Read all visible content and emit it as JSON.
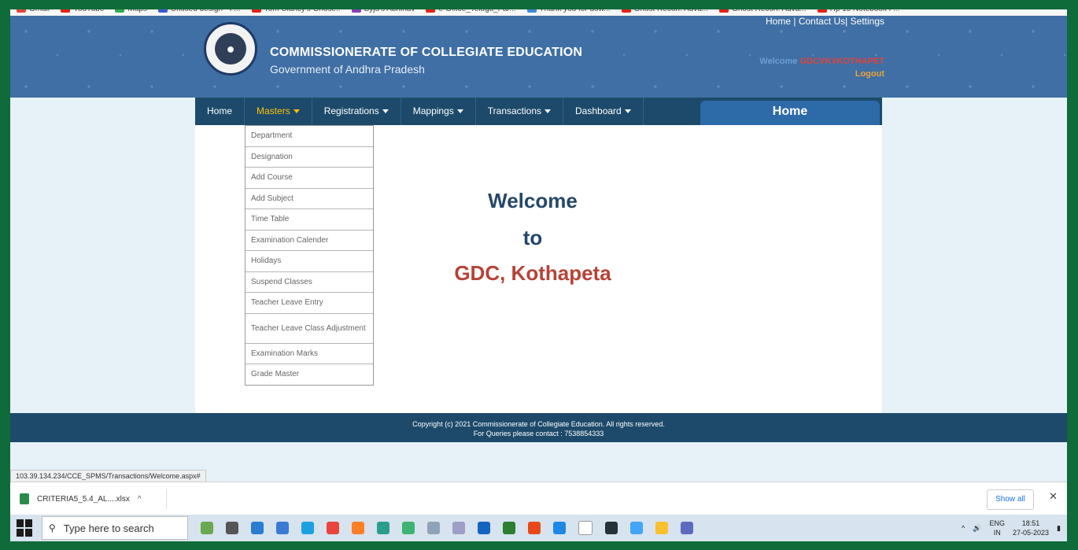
{
  "bookmarks": [
    {
      "label": "Gmail",
      "color": "#e8453c"
    },
    {
      "label": "YouTube",
      "color": "#e62117"
    },
    {
      "label": "Maps",
      "color": "#34a853"
    },
    {
      "label": "Untitled design - P...",
      "color": "#3b5bdb"
    },
    {
      "label": "Tom Clancy's Ghost...",
      "color": "#e62117"
    },
    {
      "label": "Byju's Abhinav",
      "color": "#8b3fb8"
    },
    {
      "label": "e-Office_Telugu_Far...",
      "color": "#e62117"
    },
    {
      "label": "Thank you for dow...",
      "color": "#3b8ad8"
    },
    {
      "label": "Ghost Recon: Adva...",
      "color": "#e62117"
    },
    {
      "label": "Ghost Recon: Adva...",
      "color": "#e62117"
    },
    {
      "label": "Hp 15 Notebook P...",
      "color": "#e62117"
    }
  ],
  "header": {
    "title": "COMMISSIONERATE OF COLLEGIATE EDUCATION",
    "subtitle": "Government of Andhra Pradesh",
    "links": {
      "home": "Home",
      "contact": "Contact Us",
      "settings": "Settings",
      "sep": "|"
    },
    "welcome_label": "Welcome",
    "username": "GDCVKVKOTHAPET",
    "logout": "Logout"
  },
  "nav": {
    "items": [
      {
        "label": "Home",
        "dropdown": false,
        "active": false
      },
      {
        "label": "Masters",
        "dropdown": true,
        "active": true
      },
      {
        "label": "Registrations",
        "dropdown": true,
        "active": false
      },
      {
        "label": "Mappings",
        "dropdown": true,
        "active": false
      },
      {
        "label": "Transactions",
        "dropdown": true,
        "active": false
      },
      {
        "label": "Dashboard",
        "dropdown": true,
        "active": false
      }
    ],
    "home_tab": "Home"
  },
  "masters_menu": [
    "Department",
    "Designation",
    "Add Course",
    "Add Subject",
    "Time Table",
    "Examination Calender",
    "Holidays",
    "Suspend Classes",
    "Teacher Leave Entry",
    "Teacher Leave Class Adjustment",
    "Examination Marks",
    "Grade Master"
  ],
  "welcome": {
    "line1": "Welcome",
    "line2": "to",
    "line3": "GDC, Kothapeta"
  },
  "footer": {
    "copyright": "Copyright (c) 2021 Commissionerate of Collegiate Education. All rights reserved.",
    "contact": "For Queries please contact : 7538854333"
  },
  "status_url": "103.39.134.234/CCE_SPMS/Transactions/Welcome.aspx#",
  "downloads": {
    "file": "CRITERIA5_5.4_AL....xlsx",
    "show_all": "Show all"
  },
  "taskbar": {
    "search_placeholder": "Type here to search",
    "lang1": "ENG",
    "lang2": "IN",
    "time": "18:51",
    "date": "27-05-2023",
    "app_colors": [
      "#6aa84f",
      "#555555",
      "#2b7cd3",
      "#3a7bd5",
      "#1ba1e2",
      "#e8453c",
      "#ff7f27",
      "#2a9d8f",
      "#3cb371",
      "#8fa3b8",
      "#9e9ec8",
      "#1565c0",
      "#2e7d32",
      "#e64a19",
      "#1e88e5",
      "#ffffff",
      "#263238",
      "#42a5f5",
      "#fbc02d",
      "#5c6bc0"
    ]
  }
}
